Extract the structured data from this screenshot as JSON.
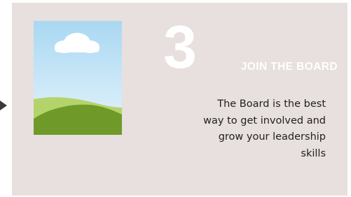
{
  "step": {
    "number": "3",
    "title": "JOIN THE BOARD",
    "body": "The Board is the best way to get involved and grow your leadership skills"
  },
  "icons": {
    "illustration": "landscape-image-placeholder-icon",
    "arrow": "chevron-right-icon"
  },
  "colors": {
    "card_background": "#e7e0de",
    "title_text": "#ffffff",
    "body_text": "#1f1f1f",
    "sky": "#bfe3f7",
    "hill_light": "#b5d36b",
    "hill_dark": "#6f9a2a"
  }
}
